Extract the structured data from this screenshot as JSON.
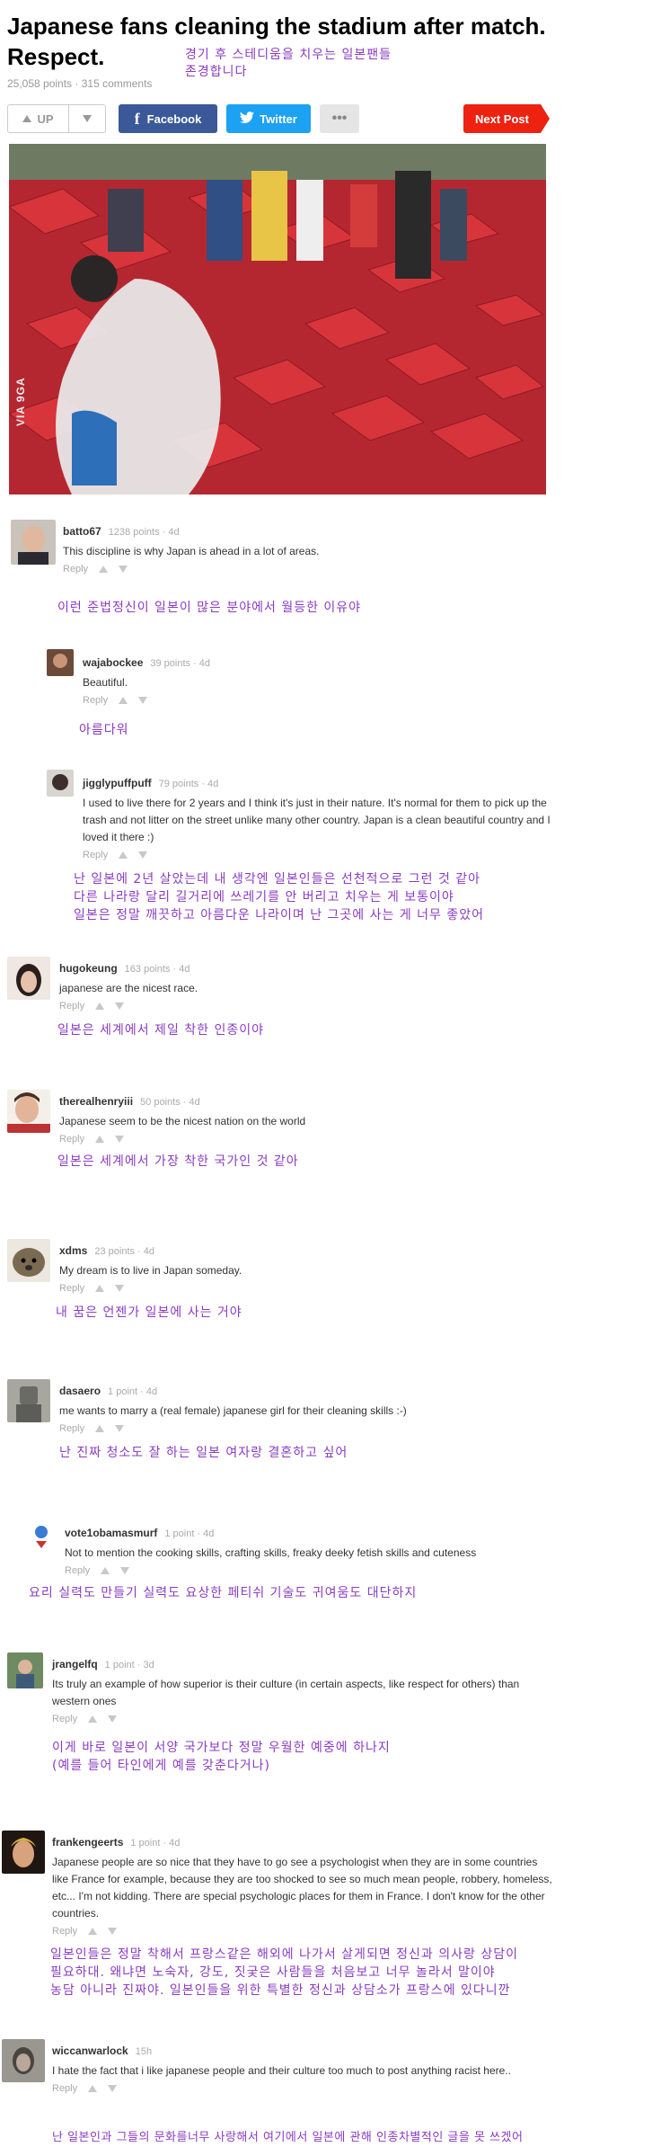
{
  "post": {
    "title": "Japanese fans cleaning the stadium after match. Respect.",
    "title_ko": "경기 후 스테디움을 치우는 일본팬들\n존경합니다",
    "meta": "25,058 points · 315 comments",
    "photo_credit": "VIA 9GA"
  },
  "toolbar": {
    "up_label": "UP",
    "facebook_label": "Facebook",
    "twitter_label": "Twitter",
    "more_label": "•••",
    "next_label": "Next Post"
  },
  "comments": [
    {
      "user": "batto67",
      "meta": "1238 points · 4d",
      "text": "This discipline is why Japan is ahead in a lot of areas.",
      "reply": "Reply",
      "ko": "이런 준법정신이 일본이 많은 분야에서 월등한 이유야"
    },
    {
      "user": "wajabockee",
      "meta": "39 points · 4d",
      "text": "Beautiful.",
      "reply": "Reply",
      "ko": "아름다워"
    },
    {
      "user": "jigglypuffpuff",
      "meta": "79 points · 4d",
      "text": "I used to live there for 2 years and I think it's just in their nature. It's normal for them to pick up the trash and not litter on the street unlike many other country. Japan is a clean beautiful country and I loved it there :)",
      "reply": "Reply",
      "ko": "난 일본에 2년 살았는데 내 생각엔 일본인들은 선천적으로 그런 것 같아\n다른 나라랑 달리 길거리에 쓰레기를 안 버리고 치우는 게 보통이야\n일본은 정말 깨끗하고 아름다운 나라이며 난 그곳에 사는 게 너무 좋았어"
    },
    {
      "user": "hugokeung",
      "meta": "163 points · 4d",
      "text": "japanese are the nicest race.",
      "reply": "Reply",
      "ko": "일본은 세계에서 제일 착한 인종이야"
    },
    {
      "user": "therealhenryiii",
      "meta": "50 points · 4d",
      "text": "Japanese seem to be the nicest nation on the world",
      "reply": "Reply",
      "ko": "일본은 세계에서 가장 착한 국가인 것 같아"
    },
    {
      "user": "xdms",
      "meta": "23 points · 4d",
      "text": "My dream is to live in Japan someday.",
      "reply": "Reply",
      "ko": "내 꿈은 언젠가 일본에 사는 거야"
    },
    {
      "user": "dasaero",
      "meta": "1 point · 4d",
      "text": "me wants to marry a (real female) japanese girl for their cleaning skills :-)",
      "reply": "Reply",
      "ko": "난 진짜 청소도 잘 하는 일본 여자랑 결혼하고 싶어"
    },
    {
      "user": "vote1obamasmurf",
      "meta": "1 point · 4d",
      "text": "Not to mention the cooking skills, crafting skills, freaky deeky fetish skills and cuteness",
      "reply": "Reply",
      "ko": "요리 실력도 만들기 실력도 요상한 페티쉬 기술도 귀여움도 대단하지"
    },
    {
      "user": "jrangelfq",
      "meta": "1 point · 3d",
      "text": "Its truly an example of how superior is their culture (in certain aspects, like respect for others) than western ones",
      "reply": "Reply",
      "ko": "이게 바로 일본이 서양 국가보다 정말 우월한 예중에 하나지\n(예를 들어 타인에게 예를 갖춘다거나)"
    },
    {
      "user": "frankengeerts",
      "meta": "1 point · 4d",
      "text": "Japanese people are so nice that they have to go see a psychologist when they are in some countries like France for example, because they are too shocked to see so much mean people, robbery, homeless, etc... I'm not kidding. There are special psychologic places for them in France. I don't know for the other countries.",
      "reply": "Reply",
      "ko": "일본인들은 정말 착해서 프랑스같은 해외에 나가서 살게되면 정신과 의사랑 상담이\n필요하대. 왜냐면 노숙자, 강도, 짓궂은 사람들을 처음보고 너무 놀라서 말이야\n농담 아니라 진짜야. 일본인들을 위한 특별한 정신과 상담소가 프랑스에 있다니깐"
    },
    {
      "user": "wiccanwarlock",
      "meta": "15h",
      "text": "I hate the fact that i like japanese people and their culture too much to post anything racist here..",
      "reply": "Reply",
      "ko": "난 일본인과 그들의 문화를너무 사랑해서 여기에서 일본에 관해 인종차별적인 글을 못 쓰겠어"
    }
  ]
}
